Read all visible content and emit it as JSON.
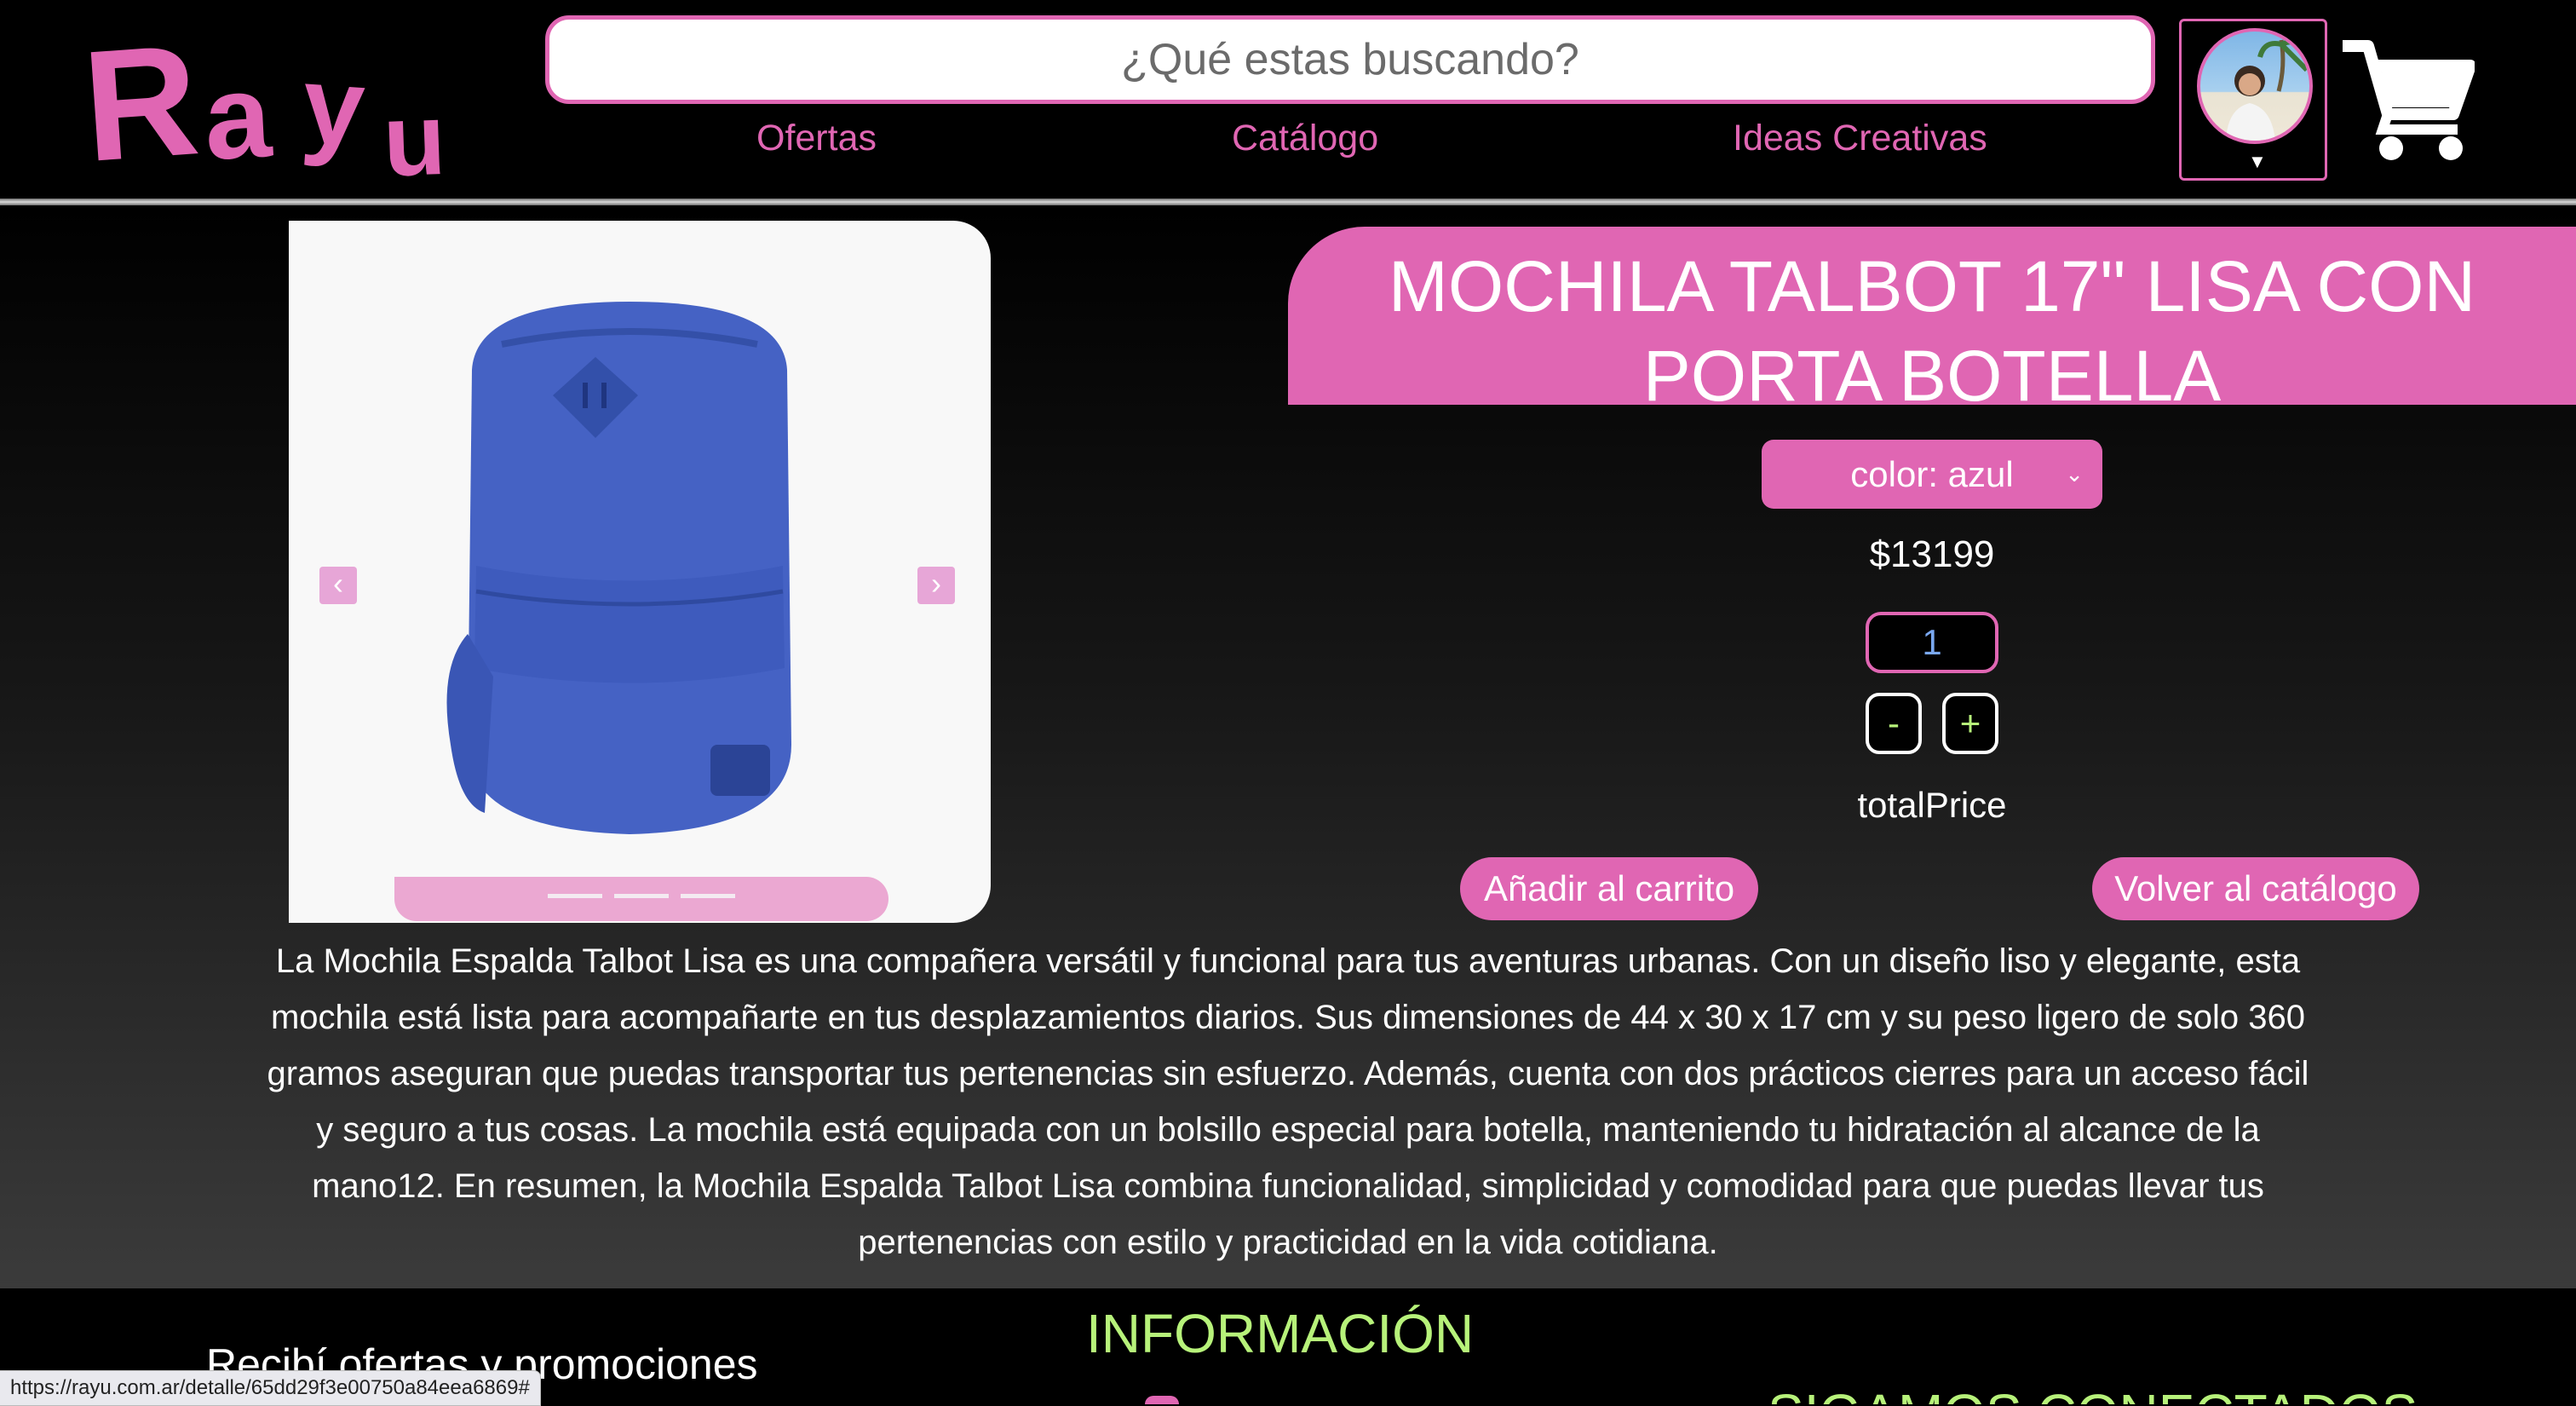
{
  "header": {
    "logo_text": "Rayu",
    "search_placeholder": "¿Qué estas buscando?",
    "nav": [
      {
        "label": "Ofertas"
      },
      {
        "label": "Catálogo"
      },
      {
        "label": "Ideas Creativas"
      }
    ],
    "avatar_icon": "user-avatar",
    "cart_icon": "shopping-cart-icon"
  },
  "product": {
    "title_line1": "MOCHILA TALBOT 17\" LISA CON",
    "title_line2": "PORTA BOTELLA",
    "color_select": "color: azul",
    "price": "$13199",
    "quantity": "1",
    "minus_label": "-",
    "plus_label": "+",
    "total_label": "totalPrice",
    "add_to_cart_label": "Añadir al carrito",
    "back_to_catalog_label": "Volver al catálogo",
    "image_color": "#3f5cb8",
    "description": "La Mochila Espalda Talbot Lisa es una compañera versátil y funcional para tus aventuras urbanas. Con un diseño liso y elegante, esta mochila está lista para acompañarte en tus desplazamientos diarios. Sus dimensiones de 44 x 30 x 17 cm y su peso ligero de solo 360 gramos aseguran que puedas transportar tus pertenencias sin esfuerzo. Además, cuenta con dos prácticos cierres para un acceso fácil y seguro a tus cosas. La mochila está equipada con un bolsillo especial para botella, manteniendo tu hidratación al alcance de la mano12. En resumen, la Mochila Espalda Talbot Lisa combina funcionalidad, simplicidad y comodidad para que puedas llevar tus pertenencias con estilo y practicidad en la vida cotidiana."
  },
  "footer": {
    "info_title": "INFORMACIÓN",
    "promo_title": "Recibí ofertas y promociones",
    "connect_title": "SIGAMOS CONECTADOS"
  },
  "status_bar": {
    "url": "https://rayu.com.ar/detalle/65dd29f3e00750a84eea6869#"
  },
  "colors": {
    "accent": "#e066b3",
    "secondary_accent": "#b7f27a",
    "background": "#000000"
  }
}
